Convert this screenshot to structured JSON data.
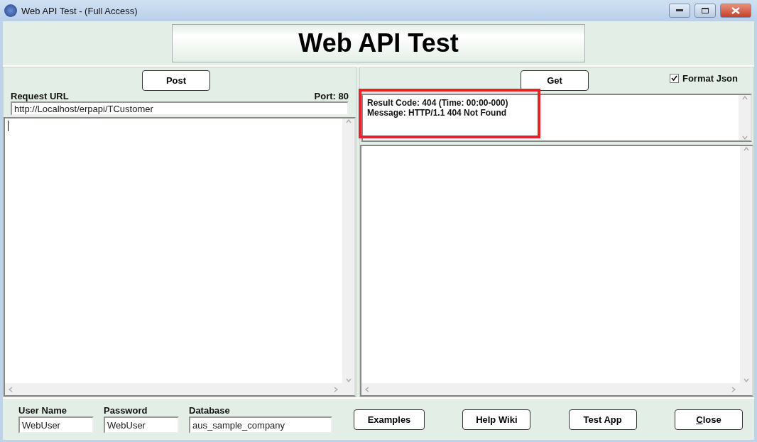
{
  "window": {
    "title": "Web API Test - (Full Access)"
  },
  "header": {
    "title": "Web API Test"
  },
  "request": {
    "button": "Post",
    "url_label": "Request URL",
    "port": "Port: 80",
    "url": "http://Localhost/erpapi/TCustomer"
  },
  "response": {
    "button": "Get",
    "format_json": {
      "label": "Format Json",
      "checked": true
    },
    "result_lines": [
      "Result Code: 404 (Time: 00:00-000)",
      "Message: HTTP/1.1 404 Not Found"
    ],
    "highlighted": true
  },
  "credentials": [
    {
      "label": "User Name",
      "value": "WebUser"
    },
    {
      "label": "Password",
      "value": "WebUser"
    },
    {
      "label": "Database",
      "value": "aus_sample_company"
    }
  ],
  "buttons": [
    {
      "label": "Examples",
      "kind": "plain"
    },
    {
      "label": "Help Wiki",
      "kind": "plain"
    },
    {
      "label": "Test App",
      "kind": "plain"
    },
    {
      "label": "Close",
      "kind": "mnemonic"
    }
  ]
}
